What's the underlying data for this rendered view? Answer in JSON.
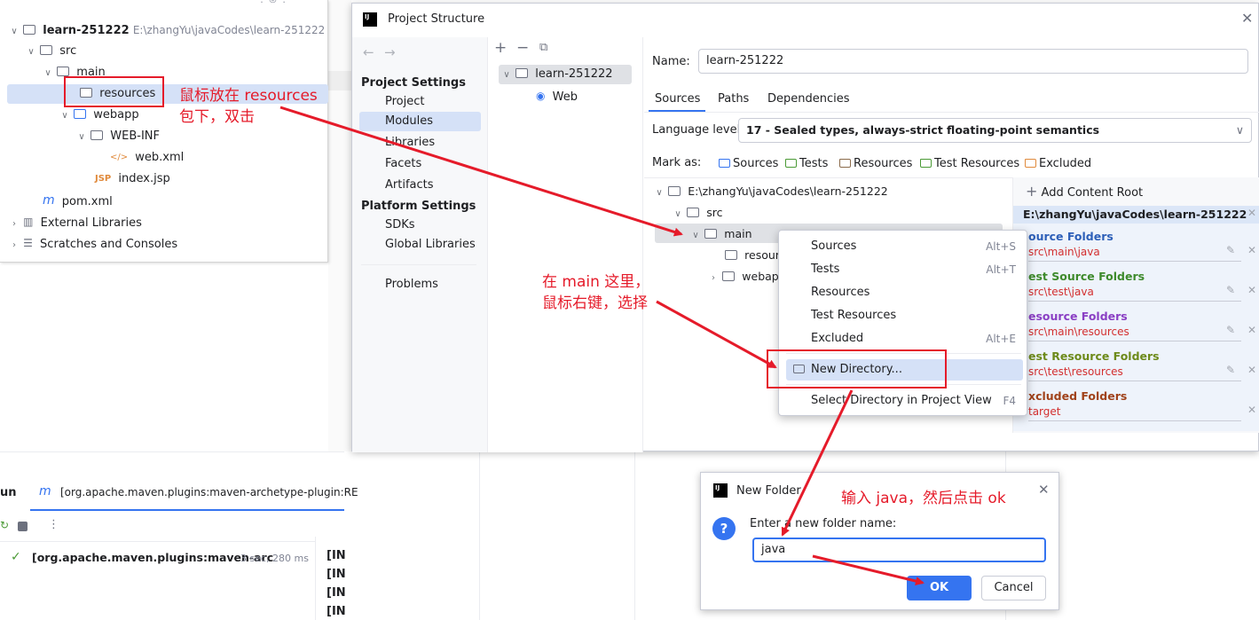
{
  "project_tree": {
    "project_name": "learn-251222",
    "project_path": "E:\\zhangYu\\javaCodes\\learn-251222",
    "items": [
      "src",
      "main",
      "resources",
      "webapp",
      "WEB-INF",
      "web.xml",
      "index.jsp",
      "pom.xml",
      "External Libraries",
      "Scratches and Consoles"
    ]
  },
  "dialog": {
    "title": "Project Structure",
    "nav_back": "←",
    "nav_forward": "→",
    "project_settings_header": "Project Settings",
    "project_settings": [
      "Project",
      "Modules",
      "Libraries",
      "Facets",
      "Artifacts"
    ],
    "platform_settings_header": "Platform Settings",
    "platform_settings": [
      "SDKs",
      "Global Libraries"
    ],
    "problems": "Problems",
    "module_tree": {
      "module": "learn-251222",
      "facet": "Web"
    },
    "name_label": "Name:",
    "name_value": "learn-251222",
    "tabs": [
      "Sources",
      "Paths",
      "Dependencies"
    ],
    "language_level_label": "Language level:",
    "language_level_value": "17 - Sealed types, always-strict floating-point semantics",
    "mark_as_label": "Mark as:",
    "mark_as": [
      {
        "label": "Sources",
        "color": "#3574f0"
      },
      {
        "label": "Tests",
        "color": "#4a9a35"
      },
      {
        "label": "Resources",
        "color": "#9b59b6"
      },
      {
        "label": "Test Resources",
        "color": "#c68a1a"
      },
      {
        "label": "Excluded",
        "color": "#e08a3c"
      }
    ],
    "content_tree": [
      "E:\\zhangYu\\javaCodes\\learn-251222",
      "src",
      "main",
      "resourc",
      "webapp"
    ],
    "add_content_root": "Add Content Root",
    "root_path": "E:\\zhangYu\\javaCodes\\learn-251222",
    "folder_categories": [
      {
        "title": "ource Folders",
        "path": "src\\main\\java",
        "color": "#2d5fb8"
      },
      {
        "title": "est Source Folders",
        "path": "src\\test\\java",
        "color": "#3e8a2c"
      },
      {
        "title": "esource Folders",
        "path": "src\\main\\resources",
        "color": "#8a3fc4"
      },
      {
        "title": "est Resource Folders",
        "path": "src\\test\\resources",
        "color": "#6d8a1a"
      },
      {
        "title": "xcluded Folders",
        "path": "target",
        "color": "#a0421a"
      }
    ]
  },
  "context_menu": {
    "items": [
      {
        "label": "Sources",
        "shortcut": "Alt+S"
      },
      {
        "label": "Tests",
        "shortcut": "Alt+T"
      },
      {
        "label": "Resources",
        "shortcut": ""
      },
      {
        "label": "Test Resources",
        "shortcut": ""
      },
      {
        "label": "Excluded",
        "shortcut": "Alt+E"
      },
      {
        "label": "New Directory...",
        "shortcut": ""
      },
      {
        "label": "Select Directory in Project View",
        "shortcut": "F4"
      }
    ]
  },
  "run_panel": {
    "tab_label": "un",
    "tab_title": "[org.apache.maven.plugins:maven-archetype-plugin:RE",
    "task": "[org.apache.maven.plugins:maven-arc",
    "duration": "3 sec, 280 ms",
    "console_lines": [
      "[IN",
      "[IN",
      "[IN",
      "[IN"
    ]
  },
  "new_folder": {
    "title": "New Folder",
    "prompt": "Enter a new folder name:",
    "value": "java",
    "ok": "OK",
    "cancel": "Cancel"
  },
  "annotations": {
    "a1_line1": "鼠标放在 resources",
    "a1_line2": "包下，双击",
    "a2_line1": "在 main 这里，",
    "a2_line2": "鼠标右键，选择",
    "a3": "输入  java，然后点击 ok",
    "color": "#e51b2a"
  }
}
